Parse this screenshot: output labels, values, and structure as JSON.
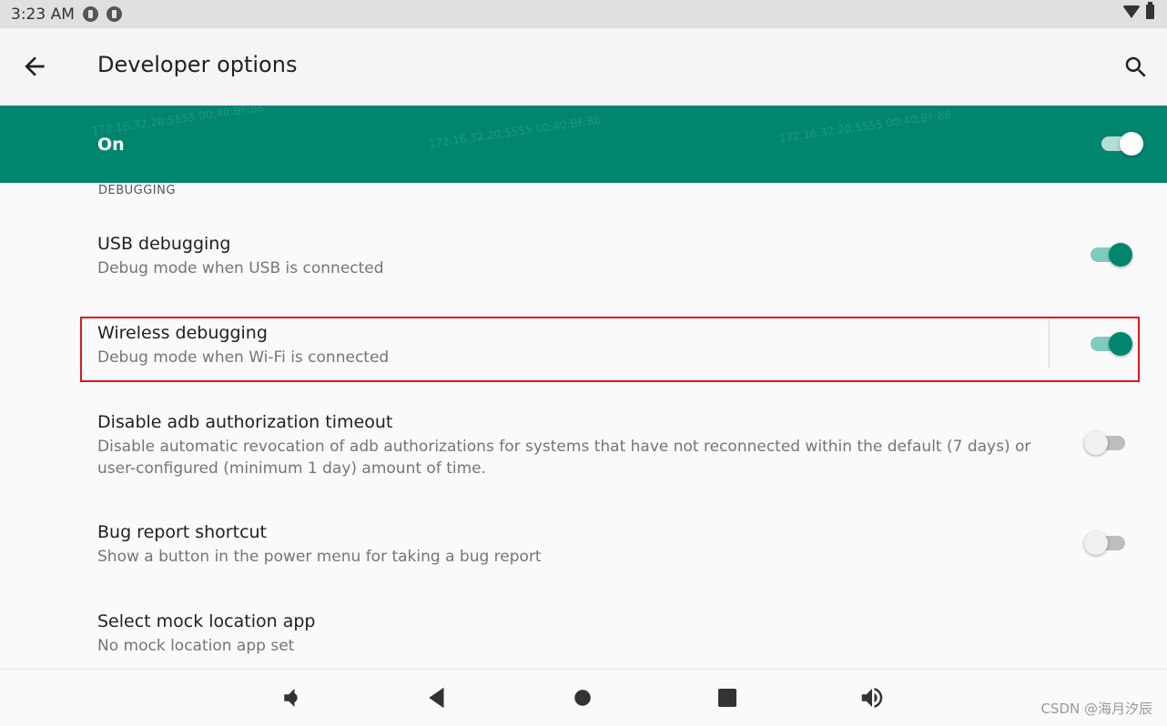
{
  "status_bar": {
    "time": "3:23 AM"
  },
  "toolbar": {
    "title": "Developer options"
  },
  "master": {
    "label": "On",
    "enabled": true
  },
  "section": {
    "header": "DEBUGGING"
  },
  "prefs": [
    {
      "title": "USB debugging",
      "summary": "Debug mode when USB is connected",
      "checked": true
    },
    {
      "title": "Wireless debugging",
      "summary": "Debug mode when Wi-Fi is connected",
      "checked": true
    },
    {
      "title": "Disable adb authorization timeout",
      "summary": "Disable automatic revocation of adb authorizations for systems that have not reconnected within the default (7 days) or user-configured (minimum 1 day) amount of time.",
      "checked": false
    },
    {
      "title": "Bug report shortcut",
      "summary": "Show a button in the power menu for taking a bug report",
      "checked": false
    },
    {
      "title": "Select mock location app",
      "summary": "No mock location app set"
    }
  ],
  "watermark_text": "172.16.32.20:5555 00:40:BF:88",
  "csdn_watermark": "CSDN @海月汐辰",
  "colors": {
    "accent": "#00866f",
    "highlight": "#e0151d"
  },
  "icons": {
    "back": "arrow-left",
    "search": "magnifier",
    "nav": [
      "volume-down",
      "back-triangle",
      "home-circle",
      "recents-square",
      "volume-up"
    ]
  }
}
